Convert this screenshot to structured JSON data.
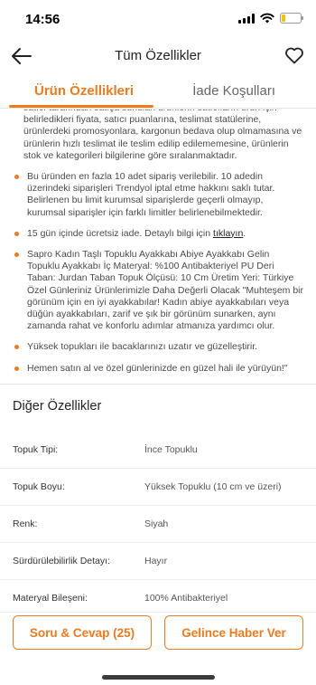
{
  "status": {
    "time": "14:56"
  },
  "header": {
    "title": "Tüm Özellikler"
  },
  "tabs": [
    {
      "label": "Ürün Özellikleri",
      "active": true
    },
    {
      "label": "İade Koşulları",
      "active": false
    }
  ],
  "description": {
    "intro_partial": "satıcı tarafından satışa sunulan ürünlerin satıcıların ürün için belirledikleri fiyata, satıcı puanlarına, teslimat statülerine, ürünlerdeki promosyonlara, kargonun bedava olup olmamasına ve ürünlerin hızlı teslimat ile teslim edilip edilememesine, ürünlerin stok ve kategorileri bilgilerine göre sıralanmaktadır.",
    "order_limit": "Bu üründen en fazla 10 adet sipariş verilebilir. 10 adedin üzerindeki siparişleri Trendyol iptal etme hakkını saklı tutar. Belirlenen bu limit kurumsal siparişlerde geçerli olmayıp, kurumsal siparişler için farklı limitler belirlenebilmektedir.",
    "return_text": "15 gün içinde ücretsiz iade. Detaylı bilgi için ",
    "return_link": "tıklayın",
    "return_end": ".",
    "product_desc": "Sapro Kadın Taşlı Topuklu Ayakkabı Abiye Ayakkabı Gelin Topuklu Ayakkabı İç Materyal: %100 Antibakteriyel PU Deri Taban: Jurdan Taban Topuk Ölçüsü: 10 Cm Üretim Yeri: Türkiye Özel Günleriniz Ürünlerimizle Daha Değerli Olacak \"Muhteşem bir görünüm için en iyi ayakkabılar! Kadın abiye ayakkabıları veya düğün ayakkabıları, zarif ve şık bir görünüm sunarken, aynı zamanda rahat ve konforlu adımlar atmanıza yardımcı olur.",
    "heels_text": "Yüksek topukları ile bacaklarınızı uzatır ve güzelleştirir.",
    "buy_text": "Hemen satın al ve özel günlerinizde en güzel hali ile yürüyün!\""
  },
  "other_specs": {
    "title": "Diğer Özellikler",
    "rows": [
      {
        "label": "Topuk Tipi:",
        "value": "İnce Topuklu"
      },
      {
        "label": "Topuk Boyu:",
        "value": "Yüksek Topuklu (10 cm ve üzeri)"
      },
      {
        "label": "Renk:",
        "value": "Siyah"
      },
      {
        "label": "Sürdürülebilirlik Detayı:",
        "value": "Hayır"
      },
      {
        "label": "Materyal Bileşeni:",
        "value": "100% Antibakteriyel"
      }
    ]
  },
  "bottom": {
    "qa_button": "Soru & Cevap (25)",
    "notify_button": "Gelince Haber Ver"
  },
  "colors": {
    "accent": "#f27a1a",
    "text": "#333333",
    "divider": "#e6e6e6"
  },
  "icons": [
    "back-arrow-icon",
    "heart-icon",
    "signal-icon",
    "wifi-icon",
    "battery-icon"
  ]
}
